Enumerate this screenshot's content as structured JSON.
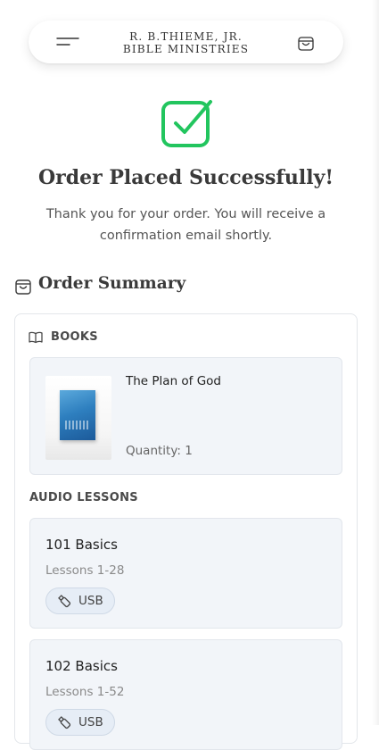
{
  "header": {
    "brand_line1": "R. B.THIEME, JR.",
    "brand_line2": "BIBLE MINISTRIES",
    "menu_icon": "hamburger-icon",
    "cart_icon": "shopping-bag-icon"
  },
  "confirmation": {
    "icon": "check-square-icon",
    "icon_color": "#22c55e",
    "title": "Order Placed Successfully!",
    "message": "Thank you for your order. You will receive a confirmation email shortly."
  },
  "summary": {
    "title": "Order Summary",
    "icon": "shopping-bag-icon",
    "books_label": "BOOKS",
    "books_icon": "open-book-icon",
    "books": [
      {
        "title": "The Plan of God",
        "quantity": "Quantity: 1"
      }
    ],
    "audio_label": "AUDIO LESSONS",
    "audio_lessons": [
      {
        "name": "101 Basics",
        "range": "Lessons 1-28",
        "format": "USB",
        "format_icon": "usb-drive-icon"
      },
      {
        "name": "102 Basics",
        "range": "Lessons 1-52",
        "format": "USB",
        "format_icon": "usb-drive-icon"
      }
    ]
  }
}
